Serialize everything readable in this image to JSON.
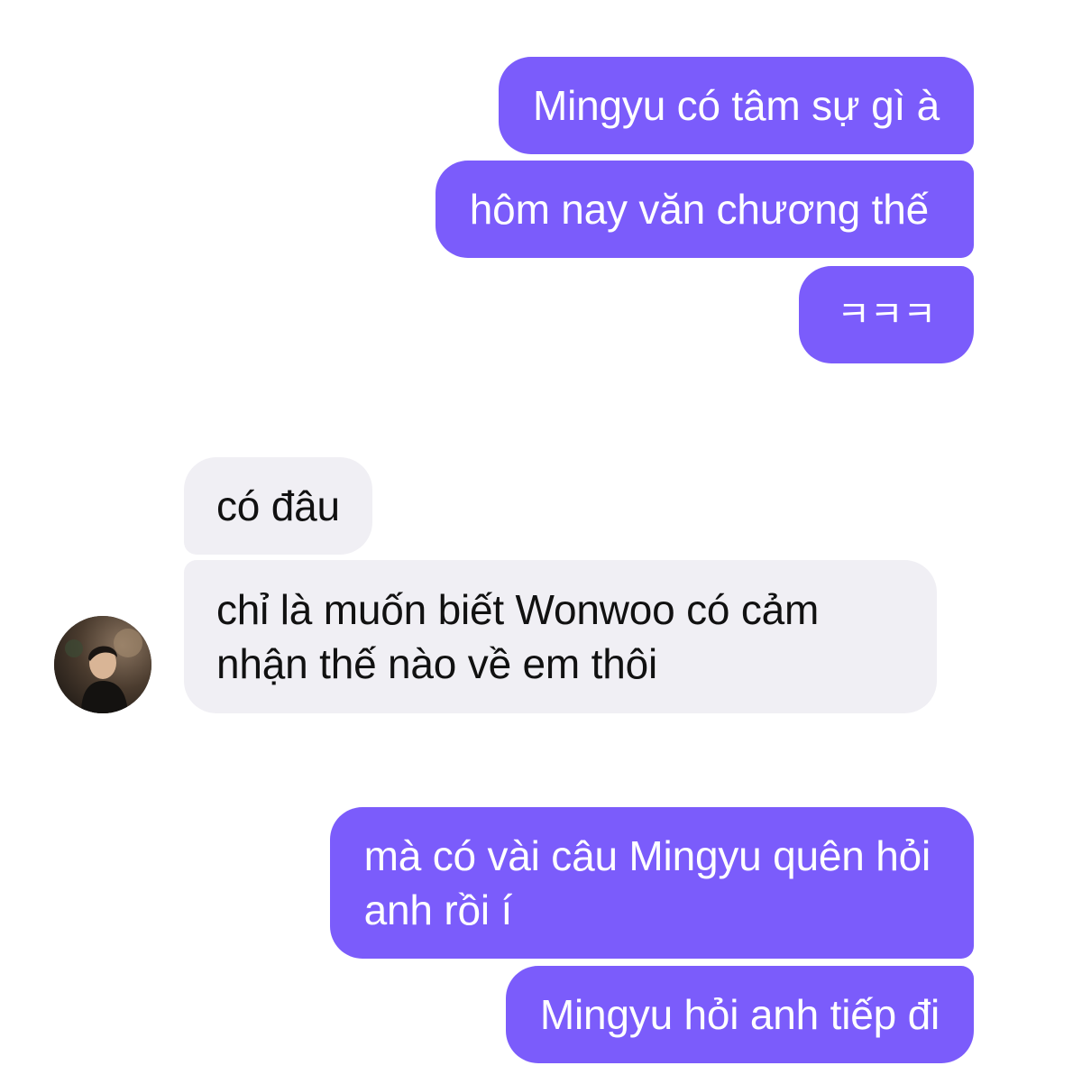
{
  "conversation": {
    "messages": [
      {
        "sender": "me",
        "text": "Mingyu có tâm sự gì à"
      },
      {
        "sender": "me",
        "text": "hôm nay văn chương thế"
      },
      {
        "sender": "me",
        "text": "ㅋㅋㅋ"
      },
      {
        "sender": "contact",
        "text": "có đâu"
      },
      {
        "sender": "contact",
        "text_line1": "chỉ là muốn biết Wonwoo có cảm",
        "text_line2": "nhận thế nào về em thôi"
      },
      {
        "sender": "me",
        "text_line1": "mà có vài câu Mingyu quên hỏi",
        "text_line2": "anh rồi í"
      },
      {
        "sender": "me",
        "text": "Mingyu hỏi anh tiếp đi"
      }
    ]
  },
  "colors": {
    "outgoing_bubble": "#7b5cfb",
    "incoming_bubble": "#f0eff4",
    "outgoing_text": "#ffffff",
    "incoming_text": "#111111"
  },
  "icons": {
    "contact_avatar": "avatar-photo"
  }
}
